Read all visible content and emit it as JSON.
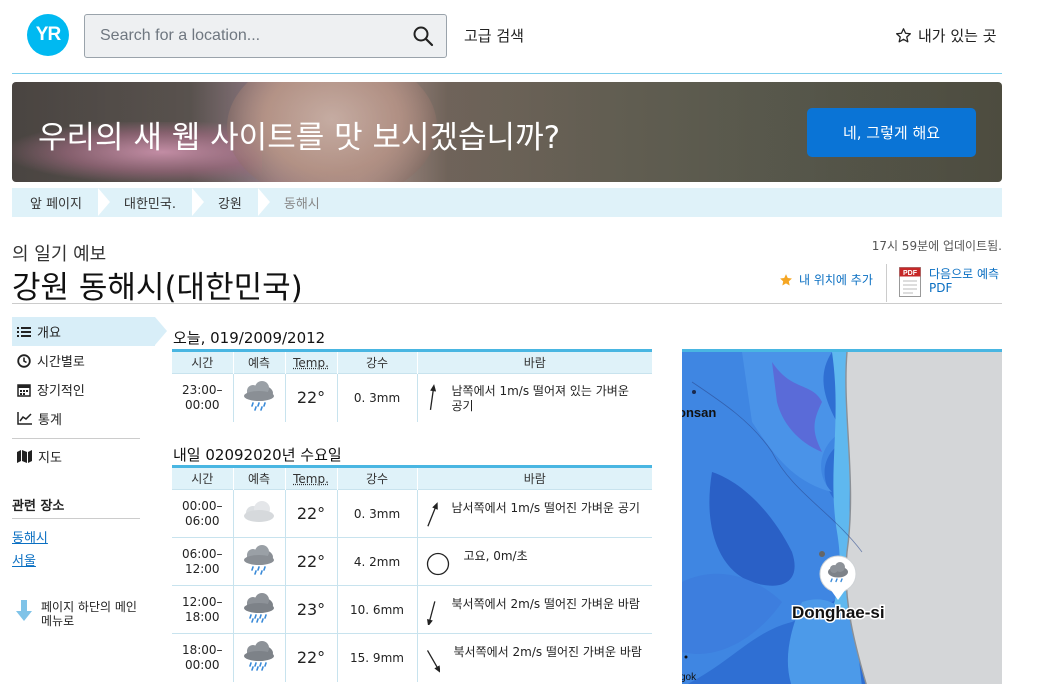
{
  "header": {
    "logo_text": "YR",
    "search_placeholder": "Search for a location...",
    "advanced_search": "고급 검색",
    "my_places": "내가 있는 곳"
  },
  "banner": {
    "text": "우리의 새 웹 사이트를 맛 보시겠습니까?",
    "button": "네, 그렇게 해요"
  },
  "breadcrumb": [
    "앞 페이지",
    "대한민국.",
    "강원",
    "동해시"
  ],
  "page": {
    "subtitle": "의 일기 예보",
    "title": "강원 동해시(대한민국)",
    "updated": "17시 59분에 업데이트됨.",
    "add_location": "내 위치에 추가",
    "pdf_label_1": "다음으로 예측",
    "pdf_label_2": "PDF",
    "pdf_icon_text": "PDF"
  },
  "sidebar": {
    "items": [
      {
        "label": "개요",
        "icon": "list-icon"
      },
      {
        "label": "시간별로",
        "icon": "clock-icon"
      },
      {
        "label": "장기적인",
        "icon": "calendar-icon"
      },
      {
        "label": "통계",
        "icon": "chart-icon"
      },
      {
        "label": "지도",
        "icon": "map-icon"
      }
    ],
    "related_title": "관련 장소",
    "related": [
      "동해시",
      "서울"
    ],
    "bottom_link_1": "페이지 하단의 메인",
    "bottom_link_2": "메뉴로"
  },
  "columns": {
    "time": "시간",
    "forecast": "예측",
    "temp": "Temp.",
    "precip": "강수",
    "wind": "바람"
  },
  "today": {
    "title": "오늘, 019/2009/2012",
    "rows": [
      {
        "time1": "23:00–",
        "time2": "00:00",
        "icon": "rain-cloud-icon",
        "temp": "22°",
        "precip": "0. 3mm",
        "wind1": "남쪽에서 1m/s 떨어져 있는 가벼운",
        "wind2": "공기"
      }
    ]
  },
  "tomorrow": {
    "title": "내일 02092020년 수요일",
    "rows": [
      {
        "time1": "00:00–",
        "time2": "06:00",
        "icon": "cloud-icon",
        "temp": "22°",
        "precip": "0. 3mm",
        "wind1": "남서쪽에서 1m/s 떨어진 가벼운 공기",
        "wind2": ""
      },
      {
        "time1": "06:00–",
        "time2": "12:00",
        "icon": "rain-cloud-icon",
        "temp": "22°",
        "precip": "4. 2mm",
        "wind1": "고요, 0m/초",
        "wind2": ""
      },
      {
        "time1": "12:00–",
        "time2": "18:00",
        "icon": "heavy-rain-cloud-icon",
        "temp": "23°",
        "precip": "10. 6mm",
        "wind1": "북서쪽에서 2m/s 떨어진 가벼운 바람",
        "wind2": ""
      },
      {
        "time1": "18:00–",
        "time2": "00:00",
        "icon": "heavy-rain-cloud-icon",
        "temp": "22°",
        "precip": "15. 9mm",
        "wind1": "북서쪽에서 2m/s 떨어진 가벼운 바람",
        "wind2": ""
      }
    ]
  },
  "map": {
    "place": "Donghae-si",
    "partial_label_top": "onsan",
    "partial_label_bottom": "gok"
  },
  "colors": {
    "accent": "#00b9f1",
    "link": "#0a6fc2",
    "temp": "#d0021b",
    "button": "#0a74d6"
  }
}
